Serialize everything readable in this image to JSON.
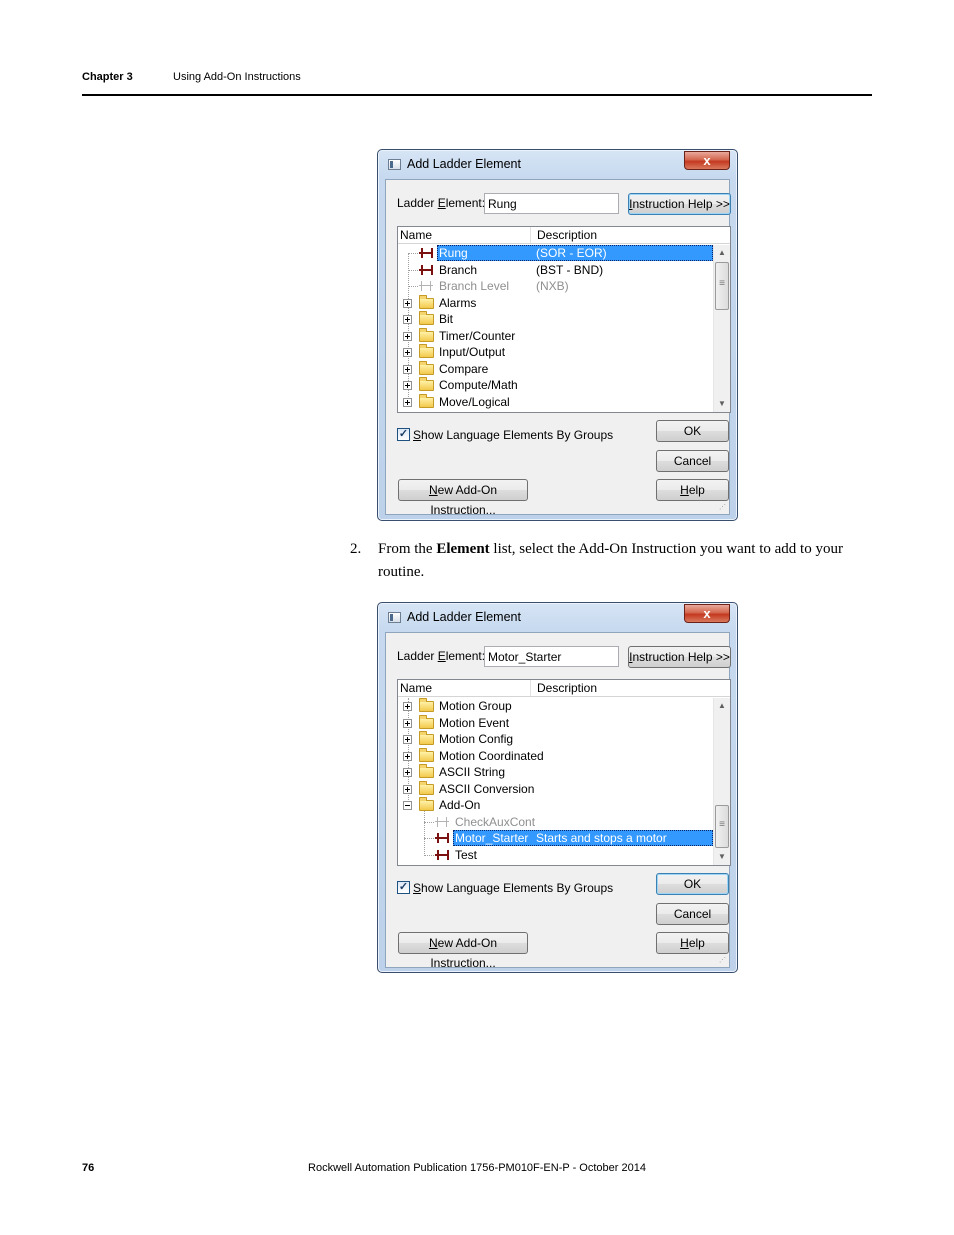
{
  "header": {
    "chapter": "Chapter 3",
    "title": "Using Add-On Instructions"
  },
  "footer": {
    "page": "76",
    "publication": "Rockwell  Automation Publication  1756-PM010F-EN-P  - October  2014"
  },
  "step": {
    "number": "2.",
    "pre": "From the ",
    "bold": "Element",
    "post": " list, select  the Add-On Instruction you want to add to your routine."
  },
  "icons": {
    "close": "close-x-icon",
    "folder": "folder-icon",
    "rung": "rung-icon",
    "expand": "expand-icon",
    "check": "check-icon"
  },
  "dialog1": {
    "title": "Add Ladder Element",
    "close": "x",
    "label_pre": "Ladder ",
    "label_u": "E",
    "label_post": "lement:",
    "element_value": "Rung",
    "help_u": "I",
    "help_rest": "nstruction Help >>",
    "col_name": "Name",
    "col_desc": "Description",
    "rows": [
      {
        "name": "Rung",
        "desc": "(SOR - EOR)"
      },
      {
        "name": "Branch",
        "desc": "(BST - BND)"
      },
      {
        "name": "Branch Level",
        "desc": "(NXB)"
      },
      {
        "name": "Alarms",
        "desc": ""
      },
      {
        "name": "Bit",
        "desc": ""
      },
      {
        "name": "Timer/Counter",
        "desc": ""
      },
      {
        "name": "Input/Output",
        "desc": ""
      },
      {
        "name": "Compare",
        "desc": ""
      },
      {
        "name": "Compute/Math",
        "desc": ""
      },
      {
        "name": "Move/Logical",
        "desc": ""
      }
    ],
    "check_mark": "✓",
    "check_u": "S",
    "check_rest": "how Language Elements By Groups",
    "ok": "OK",
    "cancel": "Cancel",
    "helpb_u": "H",
    "helpb_rest": "elp",
    "new_u": "N",
    "new_rest": "ew Add-On Instruction..."
  },
  "dialog2": {
    "title": "Add Ladder Element",
    "close": "x",
    "label_pre": "Ladder ",
    "label_u": "E",
    "label_post": "lement:",
    "element_value": "Motor_Starter",
    "help_u": "I",
    "help_rest": "nstruction Help >>",
    "col_name": "Name",
    "col_desc": "Description",
    "rows": [
      {
        "name": "Motion Group",
        "desc": ""
      },
      {
        "name": "Motion Event",
        "desc": ""
      },
      {
        "name": "Motion Config",
        "desc": ""
      },
      {
        "name": "Motion Coordinated",
        "desc": ""
      },
      {
        "name": "ASCII String",
        "desc": ""
      },
      {
        "name": "ASCII Conversion",
        "desc": ""
      },
      {
        "name": "Add-On",
        "desc": ""
      },
      {
        "name": "CheckAuxCont",
        "desc": ""
      },
      {
        "name": "Motor_Starter",
        "desc": "Starts and stops a motor"
      },
      {
        "name": "Test",
        "desc": ""
      }
    ],
    "check_mark": "✓",
    "check_u": "S",
    "check_rest": "how Language Elements By Groups",
    "ok": "OK",
    "cancel": "Cancel",
    "helpb_u": "H",
    "helpb_rest": "elp",
    "new_u": "N",
    "new_rest": "ew Add-On Instruction..."
  }
}
